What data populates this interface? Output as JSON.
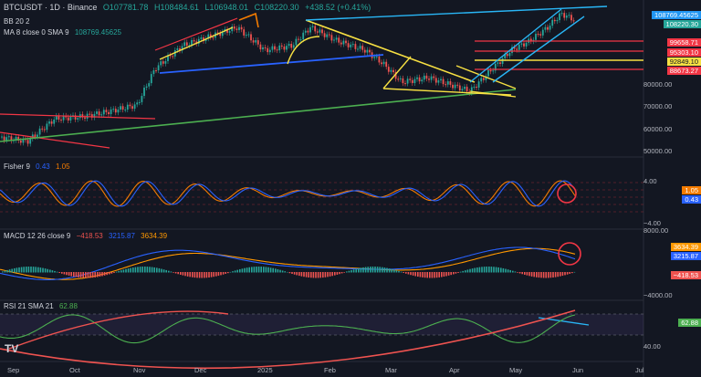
{
  "header": {
    "symbol": "BTCUSDT · 1D · Binance",
    "open": "O107781.78",
    "high": "H108484.61",
    "low": "L106948.01",
    "close": "C108220.30",
    "change": "+438.52 (+0.41%)",
    "bb_label": "BB 20 2",
    "ma_label": "MA 8 close 0 SMA 9",
    "ma_value": "108769.45625"
  },
  "price_axis": {
    "labels": [
      "80000.00",
      "70000.00",
      "60000.00",
      "50000.00"
    ],
    "tags": [
      {
        "value": "108769.45625",
        "color": "#2196f3"
      },
      {
        "value": "108220.30",
        "color": "#26a69a"
      },
      {
        "value": "99658.71",
        "color": "#f23645"
      },
      {
        "value": "95303.10",
        "color": "#f23645"
      },
      {
        "value": "92849.10",
        "color": "#f7e042"
      },
      {
        "value": "88673.27",
        "color": "#f23645"
      }
    ]
  },
  "fisher": {
    "label": "Fisher 9",
    "v1": "0.43",
    "v2": "1.05",
    "axis": [
      "4.00",
      "−4.00"
    ],
    "tags": [
      {
        "value": "1.05",
        "color": "#f57c00"
      },
      {
        "value": "0.43",
        "color": "#2962ff"
      }
    ]
  },
  "macd": {
    "label": "MACD 12 26 close 9",
    "hist": "−418.53",
    "macd": "3215.87",
    "signal": "3634.39",
    "axis": [
      "8000.00",
      "−4000.00"
    ],
    "tags": [
      {
        "value": "3634.39",
        "color": "#ff9800"
      },
      {
        "value": "3215.87",
        "color": "#2962ff"
      },
      {
        "value": "−418.53",
        "color": "#ef5350"
      }
    ]
  },
  "rsi": {
    "label": "RSI 21 SMA 21",
    "value": "62.88",
    "axis": [
      "40.00"
    ],
    "tags": [
      {
        "value": "62.88",
        "color": "#4caf50"
      }
    ]
  },
  "x_axis": [
    "Sep",
    "Oct",
    "Nov",
    "Dec",
    "2025",
    "Feb",
    "Mar",
    "Apr",
    "May",
    "Jun",
    "Jul"
  ],
  "logo": "TV",
  "colors": {
    "background": "#131722",
    "up": "#26a69a",
    "down": "#ef5350",
    "resistance": "#f23645",
    "trend_yellow": "#f7e042",
    "trend_blue": "#2962ff",
    "trend_cyan": "#29b6f6",
    "trend_green": "#4caf50"
  }
}
